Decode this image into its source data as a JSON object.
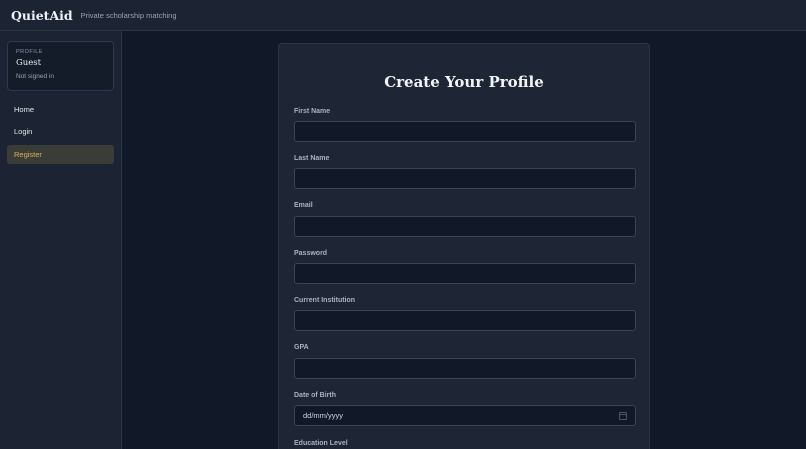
{
  "header": {
    "brand": "QuietAid",
    "tagline": "Private scholarship matching"
  },
  "sidebar": {
    "profile": {
      "label": "PROFILE",
      "name": "Guest",
      "status": "Not signed in"
    },
    "nav": [
      {
        "label": "Home"
      },
      {
        "label": "Login"
      },
      {
        "label": "Register",
        "active": true
      }
    ]
  },
  "form": {
    "title": "Create Your Profile",
    "fields": [
      {
        "label": "First Name",
        "value": ""
      },
      {
        "label": "Last Name",
        "value": ""
      },
      {
        "label": "Email",
        "value": ""
      },
      {
        "label": "Password",
        "value": ""
      },
      {
        "label": "Current Institution",
        "value": ""
      },
      {
        "label": "GPA",
        "value": ""
      },
      {
        "label": "Date of Birth",
        "value": "dd/mm/yyyy"
      },
      {
        "label": "Education Level",
        "value": ""
      }
    ]
  },
  "colors": {
    "accent": "#d6b25a",
    "background": "#111827",
    "panel": "#1c2433"
  }
}
